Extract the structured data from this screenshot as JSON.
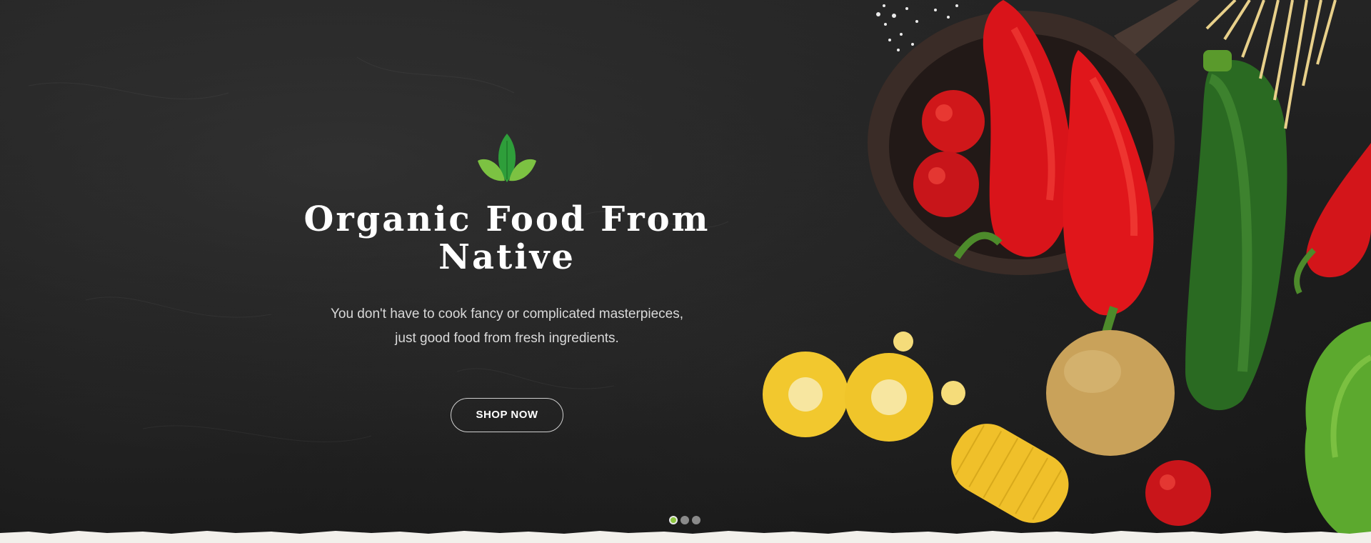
{
  "hero": {
    "logo_icon": "leaf-icon",
    "headline": "Organic Food From Native",
    "subtext_line1": "You don't have to cook fancy or complicated masterpieces,",
    "subtext_line2": "just good food from fresh ingredients.",
    "cta_label": "SHOP NOW",
    "background_image": "vegetables-on-dark-table",
    "colors": {
      "accent": "#8dc63f",
      "leaf_dark": "#2e9e3a",
      "leaf_light": "#7cc242",
      "text": "#ffffff",
      "background": "#1c1c1c",
      "page_bottom": "#f2f0eb"
    }
  },
  "slider": {
    "slides": [
      {
        "active": true
      },
      {
        "active": false
      },
      {
        "active": false
      }
    ]
  }
}
